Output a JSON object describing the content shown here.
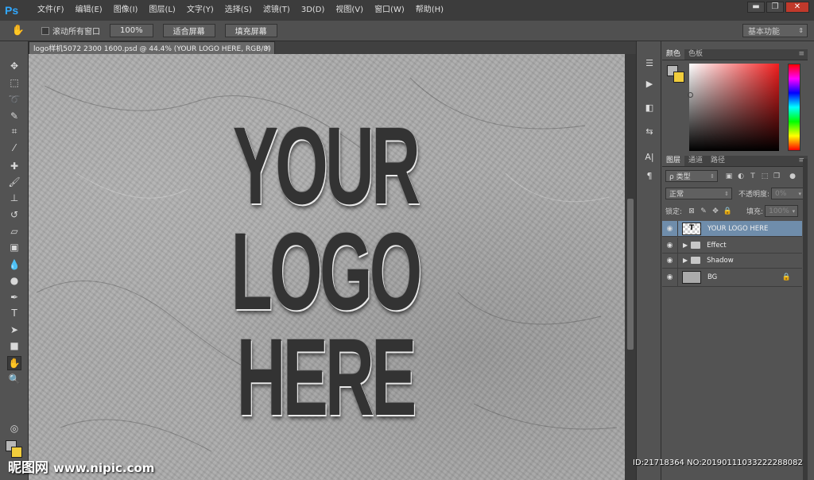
{
  "app": {
    "logo": "Ps",
    "menu": [
      "文件(F)",
      "编辑(E)",
      "图像(I)",
      "图层(L)",
      "文字(Y)",
      "选择(S)",
      "滤镜(T)",
      "3D(D)",
      "视图(V)",
      "窗口(W)",
      "帮助(H)"
    ],
    "window_controls": {
      "minimize": "▬",
      "restore": "❐",
      "close": "✕"
    }
  },
  "options_bar": {
    "tool_icon": "hand-icon",
    "scroll_all_label": "滚动所有窗口",
    "zoom_100": "100%",
    "fit_screen": "适合屏幕",
    "fill_screen": "填充屏幕",
    "workspace": "基本功能"
  },
  "document": {
    "tab_title": "logo样机5072 2300 1600.psd @ 44.4% (YOUR LOGO HERE, RGB/8)",
    "tab_close": "×",
    "logo_lines": [
      "YOUR",
      "LOGO",
      "HERE"
    ]
  },
  "tools": [
    {
      "name": "move-tool-icon",
      "glyph": "✥"
    },
    {
      "name": "marquee-tool-icon",
      "glyph": "⬚"
    },
    {
      "name": "lasso-tool-icon",
      "glyph": "➰"
    },
    {
      "name": "quick-select-tool-icon",
      "glyph": "✎"
    },
    {
      "name": "crop-tool-icon",
      "glyph": "⌗"
    },
    {
      "name": "eyedropper-tool-icon",
      "glyph": "⁄"
    },
    {
      "name": "healing-brush-tool-icon",
      "glyph": "✚"
    },
    {
      "name": "brush-tool-icon",
      "glyph": "🖌"
    },
    {
      "name": "stamp-tool-icon",
      "glyph": "⊥"
    },
    {
      "name": "history-brush-tool-icon",
      "glyph": "↺"
    },
    {
      "name": "eraser-tool-icon",
      "glyph": "▱"
    },
    {
      "name": "gradient-tool-icon",
      "glyph": "▣"
    },
    {
      "name": "blur-tool-icon",
      "glyph": "💧"
    },
    {
      "name": "dodge-tool-icon",
      "glyph": "●"
    },
    {
      "name": "pen-tool-icon",
      "glyph": "✒"
    },
    {
      "name": "type-tool-icon",
      "glyph": "T"
    },
    {
      "name": "path-select-tool-icon",
      "glyph": "➤"
    },
    {
      "name": "rectangle-tool-icon",
      "glyph": "■"
    },
    {
      "name": "hand-tool-icon",
      "glyph": "✋"
    },
    {
      "name": "zoom-tool-icon",
      "glyph": "🔍"
    }
  ],
  "dock": [
    {
      "name": "history-panel-icon",
      "glyph": "☰"
    },
    {
      "name": "actions-panel-icon",
      "glyph": "▶"
    },
    {
      "name": "adjustments-panel-icon",
      "glyph": "◧"
    },
    {
      "name": "properties-panel-icon",
      "glyph": "⇆"
    },
    {
      "name": "character-panel-icon",
      "glyph": "A|"
    },
    {
      "name": "paragraph-panel-icon",
      "glyph": "¶"
    }
  ],
  "color_panel": {
    "tabs": [
      "颜色",
      "色板"
    ],
    "fg_color": "#b8b8b8",
    "bg_color": "#f1cd3c"
  },
  "layers_panel": {
    "tabs": [
      "图层",
      "通道",
      "路径"
    ],
    "filter_label": "ρ 类型",
    "blend_mode": "正常",
    "opacity_label": "不透明度:",
    "opacity_value": "0%",
    "lock_label": "锁定:",
    "fill_label": "填充:",
    "fill_value": "100%",
    "layers": [
      {
        "name": "YOUR LOGO HERE",
        "type": "smart",
        "selected": true
      },
      {
        "name": "Effect",
        "type": "group"
      },
      {
        "name": "Shadow",
        "type": "group"
      },
      {
        "name": "BG",
        "type": "image",
        "locked": true
      }
    ]
  },
  "watermark": {
    "left_brand": "昵图网",
    "left_site": "www.nipic.com",
    "right_id": "ID:21718364 NO:20190111033222288082"
  }
}
